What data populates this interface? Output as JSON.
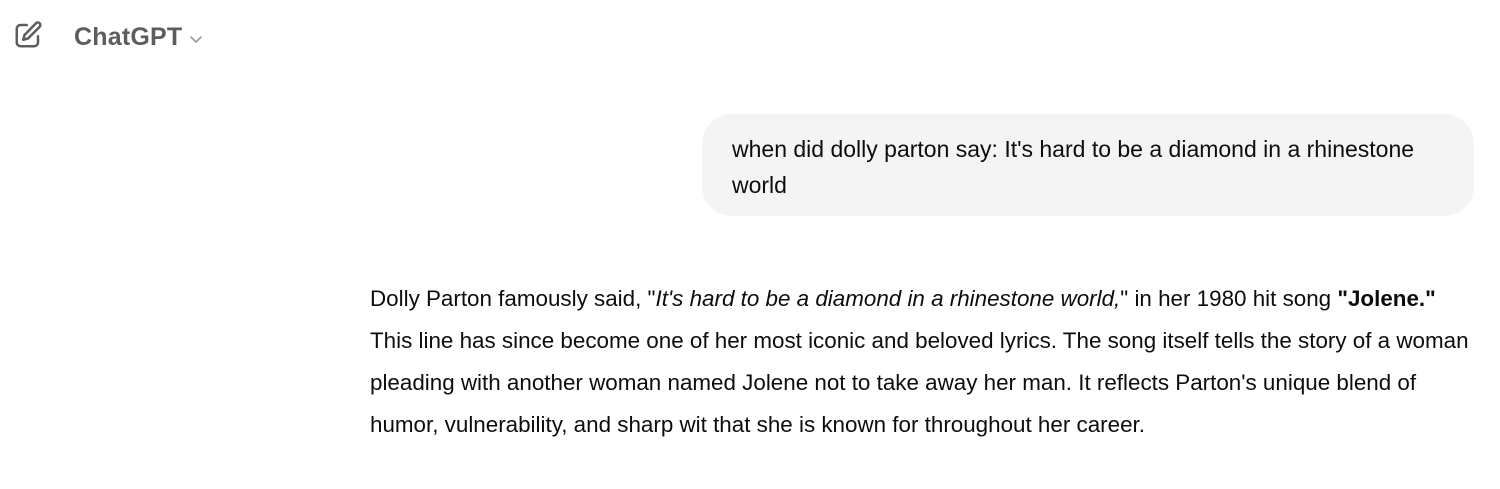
{
  "header": {
    "model_name": "ChatGPT",
    "new_chat_icon": "edit-pencil-icon",
    "dropdown_icon": "chevron-down-icon",
    "icon_color": "#5d5d5d"
  },
  "conversation": {
    "user_message": {
      "text": "when did dolly parton say: It's hard to be a diamond in a rhinestone world"
    },
    "assistant_message": {
      "part1": "Dolly Parton famously said, \"",
      "quote": "It's hard to be a diamond in a rhinestone world,",
      "part2": "\" in her 1980 hit song ",
      "song_title": "\"Jolene.\"",
      "part3": " This line has since become one of her most iconic and beloved lyrics. The song itself tells the story of a woman pleading with another woman named Jolene not to take away her man. It reflects Parton's unique blend of humor, vulnerability, and sharp wit that she is known for throughout her career."
    }
  },
  "colors": {
    "user_bubble_bg": "#f4f4f4",
    "text": "#0d0d0d",
    "header_text": "#5d5d5d"
  }
}
